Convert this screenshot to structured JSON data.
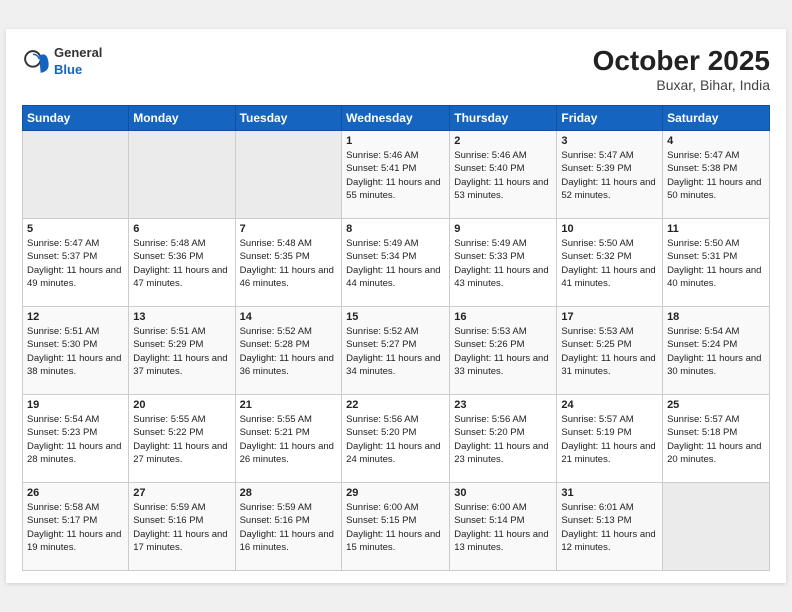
{
  "header": {
    "logo_general": "General",
    "logo_blue": "Blue",
    "month": "October 2025",
    "location": "Buxar, Bihar, India"
  },
  "days_of_week": [
    "Sunday",
    "Monday",
    "Tuesday",
    "Wednesday",
    "Thursday",
    "Friday",
    "Saturday"
  ],
  "weeks": [
    [
      {
        "day": "",
        "empty": true
      },
      {
        "day": "",
        "empty": true
      },
      {
        "day": "",
        "empty": true
      },
      {
        "day": "1",
        "sunrise": "5:46 AM",
        "sunset": "5:41 PM",
        "daylight": "11 hours and 55 minutes."
      },
      {
        "day": "2",
        "sunrise": "5:46 AM",
        "sunset": "5:40 PM",
        "daylight": "11 hours and 53 minutes."
      },
      {
        "day": "3",
        "sunrise": "5:47 AM",
        "sunset": "5:39 PM",
        "daylight": "11 hours and 52 minutes."
      },
      {
        "day": "4",
        "sunrise": "5:47 AM",
        "sunset": "5:38 PM",
        "daylight": "11 hours and 50 minutes."
      }
    ],
    [
      {
        "day": "5",
        "sunrise": "5:47 AM",
        "sunset": "5:37 PM",
        "daylight": "11 hours and 49 minutes."
      },
      {
        "day": "6",
        "sunrise": "5:48 AM",
        "sunset": "5:36 PM",
        "daylight": "11 hours and 47 minutes."
      },
      {
        "day": "7",
        "sunrise": "5:48 AM",
        "sunset": "5:35 PM",
        "daylight": "11 hours and 46 minutes."
      },
      {
        "day": "8",
        "sunrise": "5:49 AM",
        "sunset": "5:34 PM",
        "daylight": "11 hours and 44 minutes."
      },
      {
        "day": "9",
        "sunrise": "5:49 AM",
        "sunset": "5:33 PM",
        "daylight": "11 hours and 43 minutes."
      },
      {
        "day": "10",
        "sunrise": "5:50 AM",
        "sunset": "5:32 PM",
        "daylight": "11 hours and 41 minutes."
      },
      {
        "day": "11",
        "sunrise": "5:50 AM",
        "sunset": "5:31 PM",
        "daylight": "11 hours and 40 minutes."
      }
    ],
    [
      {
        "day": "12",
        "sunrise": "5:51 AM",
        "sunset": "5:30 PM",
        "daylight": "11 hours and 38 minutes."
      },
      {
        "day": "13",
        "sunrise": "5:51 AM",
        "sunset": "5:29 PM",
        "daylight": "11 hours and 37 minutes."
      },
      {
        "day": "14",
        "sunrise": "5:52 AM",
        "sunset": "5:28 PM",
        "daylight": "11 hours and 36 minutes."
      },
      {
        "day": "15",
        "sunrise": "5:52 AM",
        "sunset": "5:27 PM",
        "daylight": "11 hours and 34 minutes."
      },
      {
        "day": "16",
        "sunrise": "5:53 AM",
        "sunset": "5:26 PM",
        "daylight": "11 hours and 33 minutes."
      },
      {
        "day": "17",
        "sunrise": "5:53 AM",
        "sunset": "5:25 PM",
        "daylight": "11 hours and 31 minutes."
      },
      {
        "day": "18",
        "sunrise": "5:54 AM",
        "sunset": "5:24 PM",
        "daylight": "11 hours and 30 minutes."
      }
    ],
    [
      {
        "day": "19",
        "sunrise": "5:54 AM",
        "sunset": "5:23 PM",
        "daylight": "11 hours and 28 minutes."
      },
      {
        "day": "20",
        "sunrise": "5:55 AM",
        "sunset": "5:22 PM",
        "daylight": "11 hours and 27 minutes."
      },
      {
        "day": "21",
        "sunrise": "5:55 AM",
        "sunset": "5:21 PM",
        "daylight": "11 hours and 26 minutes."
      },
      {
        "day": "22",
        "sunrise": "5:56 AM",
        "sunset": "5:20 PM",
        "daylight": "11 hours and 24 minutes."
      },
      {
        "day": "23",
        "sunrise": "5:56 AM",
        "sunset": "5:20 PM",
        "daylight": "11 hours and 23 minutes."
      },
      {
        "day": "24",
        "sunrise": "5:57 AM",
        "sunset": "5:19 PM",
        "daylight": "11 hours and 21 minutes."
      },
      {
        "day": "25",
        "sunrise": "5:57 AM",
        "sunset": "5:18 PM",
        "daylight": "11 hours and 20 minutes."
      }
    ],
    [
      {
        "day": "26",
        "sunrise": "5:58 AM",
        "sunset": "5:17 PM",
        "daylight": "11 hours and 19 minutes."
      },
      {
        "day": "27",
        "sunrise": "5:59 AM",
        "sunset": "5:16 PM",
        "daylight": "11 hours and 17 minutes."
      },
      {
        "day": "28",
        "sunrise": "5:59 AM",
        "sunset": "5:16 PM",
        "daylight": "11 hours and 16 minutes."
      },
      {
        "day": "29",
        "sunrise": "6:00 AM",
        "sunset": "5:15 PM",
        "daylight": "11 hours and 15 minutes."
      },
      {
        "day": "30",
        "sunrise": "6:00 AM",
        "sunset": "5:14 PM",
        "daylight": "11 hours and 13 minutes."
      },
      {
        "day": "31",
        "sunrise": "6:01 AM",
        "sunset": "5:13 PM",
        "daylight": "11 hours and 12 minutes."
      },
      {
        "day": "",
        "empty": true
      }
    ]
  ]
}
